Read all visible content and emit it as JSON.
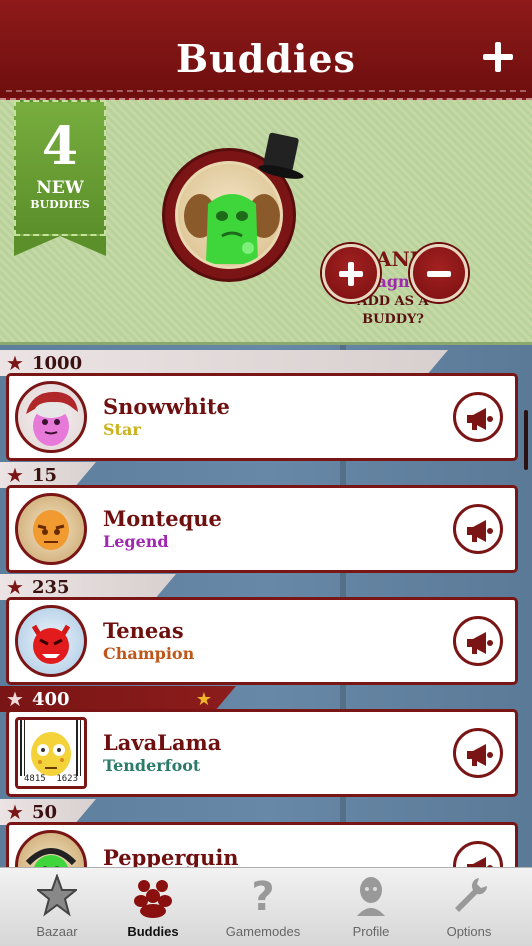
{
  "header": {
    "title": "Buddies",
    "add_label": "+"
  },
  "featured": {
    "ribbon_count": "4",
    "ribbon_new": "NEW",
    "ribbon_buddies": "BUDDIES",
    "name": "FRANKY",
    "rank": "Magnet",
    "question_line1": "ADD AS A",
    "question_line2": "BUDDY?",
    "accept_icon": "plus-icon",
    "decline_icon": "minus-icon"
  },
  "buddies": [
    {
      "score": "1000",
      "name": "Snowwhite",
      "rank": "Star",
      "rank_color": "#c9b21a",
      "avatar": "pink-monster"
    },
    {
      "score": "15",
      "name": "Monteque",
      "rank": "Legend",
      "rank_color": "#a028b0",
      "avatar": "orange-monster"
    },
    {
      "score": "235",
      "name": "Teneas",
      "rank": "Champion",
      "rank_color": "#c0571a",
      "avatar": "red-monster"
    },
    {
      "score": "400",
      "name": "LavaLama",
      "rank": "Tenderfoot",
      "rank_color": "#2a7a6a",
      "avatar": "yellow-monster",
      "barcode_left": "4815",
      "barcode_right": "1623"
    },
    {
      "score": "50",
      "name": "Pepperguin",
      "rank": "",
      "rank_color": "#333333",
      "avatar": "green-monster"
    }
  ],
  "tabs": [
    {
      "label": "Bazaar",
      "icon": "star-icon",
      "active": false
    },
    {
      "label": "Buddies",
      "icon": "buddies-icon",
      "active": true
    },
    {
      "label": "Gamemodes",
      "icon": "question-icon",
      "active": false
    },
    {
      "label": "Profile",
      "icon": "profile-icon",
      "active": false
    },
    {
      "label": "Options",
      "icon": "wrench-icon",
      "active": false
    }
  ]
}
